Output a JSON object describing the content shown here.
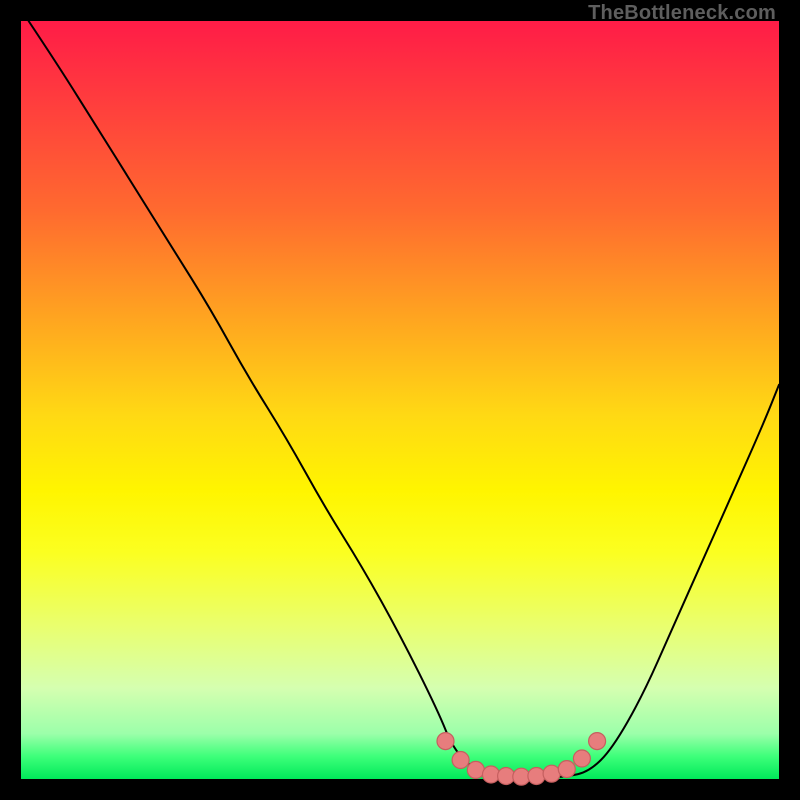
{
  "watermark": "TheBottleneck.com",
  "chart_data": {
    "type": "line",
    "title": "",
    "xlabel": "",
    "ylabel": "",
    "xlim": [
      0,
      100
    ],
    "ylim": [
      0,
      100
    ],
    "grid": false,
    "legend": false,
    "series": [
      {
        "name": "bottleneck-curve",
        "x": [
          1,
          5,
          10,
          15,
          20,
          25,
          30,
          35,
          40,
          45,
          50,
          55,
          57,
          60,
          63,
          66,
          69,
          72,
          75,
          78,
          82,
          86,
          90,
          94,
          98,
          100
        ],
        "y": [
          100,
          94,
          86,
          78,
          70,
          62,
          53,
          45,
          36,
          28,
          19,
          9,
          4,
          1,
          0.3,
          0.2,
          0.2,
          0.3,
          1,
          4,
          11,
          20,
          29,
          38,
          47,
          52
        ],
        "stroke": "#000000",
        "stroke_width": 2
      }
    ],
    "markers": {
      "name": "highlight-points",
      "color": "#e77d7d",
      "points": [
        {
          "x": 56,
          "y": 5
        },
        {
          "x": 58,
          "y": 2.5
        },
        {
          "x": 60,
          "y": 1.2
        },
        {
          "x": 62,
          "y": 0.6
        },
        {
          "x": 64,
          "y": 0.4
        },
        {
          "x": 66,
          "y": 0.3
        },
        {
          "x": 68,
          "y": 0.4
        },
        {
          "x": 70,
          "y": 0.7
        },
        {
          "x": 72,
          "y": 1.3
        },
        {
          "x": 74,
          "y": 2.7
        },
        {
          "x": 76,
          "y": 5
        }
      ]
    },
    "background_gradient": {
      "top": "#ff1c47",
      "bottom": "#00e95a"
    }
  }
}
